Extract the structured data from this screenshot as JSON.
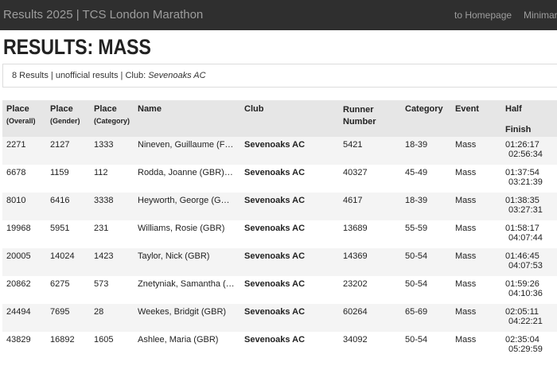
{
  "header": {
    "title": "Results 2025 | TCS London Marathon",
    "nav": [
      "to Homepage",
      "Minimara"
    ]
  },
  "page_title": "RESULTS: MASS",
  "info": {
    "prefix": "8 Results | unofficial results | Club: ",
    "club": "Sevenoaks AC"
  },
  "table": {
    "headers": {
      "place_overall": "Place",
      "place_overall_sub": "(Overall)",
      "place_gender": "Place",
      "place_gender_sub": "(Gender)",
      "place_category": "Place",
      "place_category_sub": "(Category)",
      "name": "Name",
      "club": "Club",
      "runner_number": "Runner Number",
      "category": "Category",
      "event": "Event",
      "half": "Half",
      "finish": "Finish"
    },
    "rows": [
      {
        "overall": "2271",
        "gender": "2127",
        "category_place": "1333",
        "name": "Nineven, Guillaume (F…",
        "club": "Sevenoaks AC",
        "number": "5421",
        "category": "18-39",
        "event": "Mass",
        "half": "01:26:17",
        "finish": "02:56:34"
      },
      {
        "overall": "6678",
        "gender": "1159",
        "category_place": "112",
        "name": "Rodda, Joanne (GBR)…",
        "club": "Sevenoaks AC",
        "number": "40327",
        "category": "45-49",
        "event": "Mass",
        "half": "01:37:54",
        "finish": "03:21:39"
      },
      {
        "overall": "8010",
        "gender": "6416",
        "category_place": "3338",
        "name": "Heyworth, George (G…",
        "club": "Sevenoaks AC",
        "number": "4617",
        "category": "18-39",
        "event": "Mass",
        "half": "01:38:35",
        "finish": "03:27:31"
      },
      {
        "overall": "19968",
        "gender": "5951",
        "category_place": "231",
        "name": "Williams, Rosie (GBR)",
        "club": "Sevenoaks AC",
        "number": "13689",
        "category": "55-59",
        "event": "Mass",
        "half": "01:58:17",
        "finish": "04:07:44"
      },
      {
        "overall": "20005",
        "gender": "14024",
        "category_place": "1423",
        "name": "Taylor, Nick (GBR)",
        "club": "Sevenoaks AC",
        "number": "14369",
        "category": "50-54",
        "event": "Mass",
        "half": "01:46:45",
        "finish": "04:07:53"
      },
      {
        "overall": "20862",
        "gender": "6275",
        "category_place": "573",
        "name": "Znetyniak, Samantha (…",
        "club": "Sevenoaks AC",
        "number": "23202",
        "category": "50-54",
        "event": "Mass",
        "half": "01:59:26",
        "finish": "04:10:36"
      },
      {
        "overall": "24494",
        "gender": "7695",
        "category_place": "28",
        "name": "Weekes, Bridgit (GBR)",
        "club": "Sevenoaks AC",
        "number": "60264",
        "category": "65-69",
        "event": "Mass",
        "half": "02:05:11",
        "finish": "04:22:21"
      },
      {
        "overall": "43829",
        "gender": "16892",
        "category_place": "1605",
        "name": "Ashlee, Maria (GBR)",
        "club": "Sevenoaks AC",
        "number": "34092",
        "category": "50-54",
        "event": "Mass",
        "half": "02:35:04",
        "finish": "05:29:59"
      }
    ]
  }
}
